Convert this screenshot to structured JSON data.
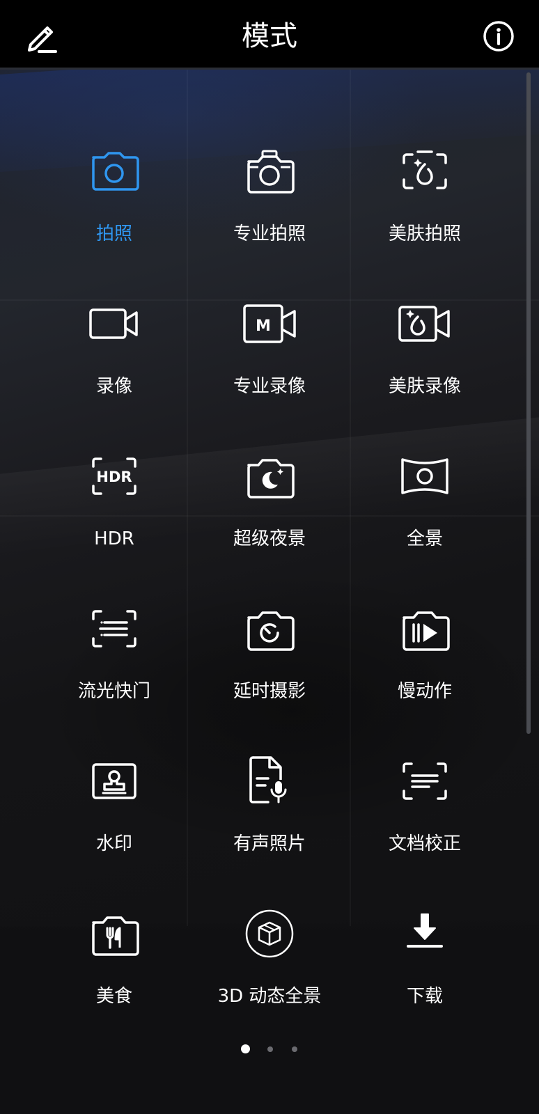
{
  "header": {
    "title": "模式"
  },
  "modes": [
    {
      "label": "拍照",
      "icon": "camera-icon",
      "active": true
    },
    {
      "label": "专业拍照",
      "icon": "pro-camera-icon",
      "active": false
    },
    {
      "label": "美肤拍照",
      "icon": "beauty-camera-icon",
      "active": false
    },
    {
      "label": "录像",
      "icon": "video-icon",
      "active": false
    },
    {
      "label": "专业录像",
      "icon": "pro-video-icon",
      "active": false
    },
    {
      "label": "美肤录像",
      "icon": "beauty-video-icon",
      "active": false
    },
    {
      "label": "HDR",
      "icon": "hdr-icon",
      "active": false
    },
    {
      "label": "超级夜景",
      "icon": "night-mode-icon",
      "active": false
    },
    {
      "label": "全景",
      "icon": "panorama-icon",
      "active": false
    },
    {
      "label": "流光快门",
      "icon": "light-painting-icon",
      "active": false
    },
    {
      "label": "延时摄影",
      "icon": "time-lapse-icon",
      "active": false
    },
    {
      "label": "慢动作",
      "icon": "slow-motion-icon",
      "active": false
    },
    {
      "label": "水印",
      "icon": "watermark-icon",
      "active": false
    },
    {
      "label": "有声照片",
      "icon": "audio-photo-icon",
      "active": false
    },
    {
      "label": "文档校正",
      "icon": "document-scan-icon",
      "active": false
    },
    {
      "label": "美食",
      "icon": "food-icon",
      "active": false
    },
    {
      "label": "3D 动态全景",
      "icon": "3d-panorama-icon",
      "active": false
    },
    {
      "label": "下载",
      "icon": "download-icon",
      "active": false
    }
  ],
  "icons_text": {
    "pro_video_letter": "M",
    "hdr_text": "HDR"
  },
  "pagination": {
    "pages": 3,
    "current": 1
  },
  "colors": {
    "accent": "#2f96f0",
    "icon": "#ffffff",
    "header_bg": "#000000"
  }
}
